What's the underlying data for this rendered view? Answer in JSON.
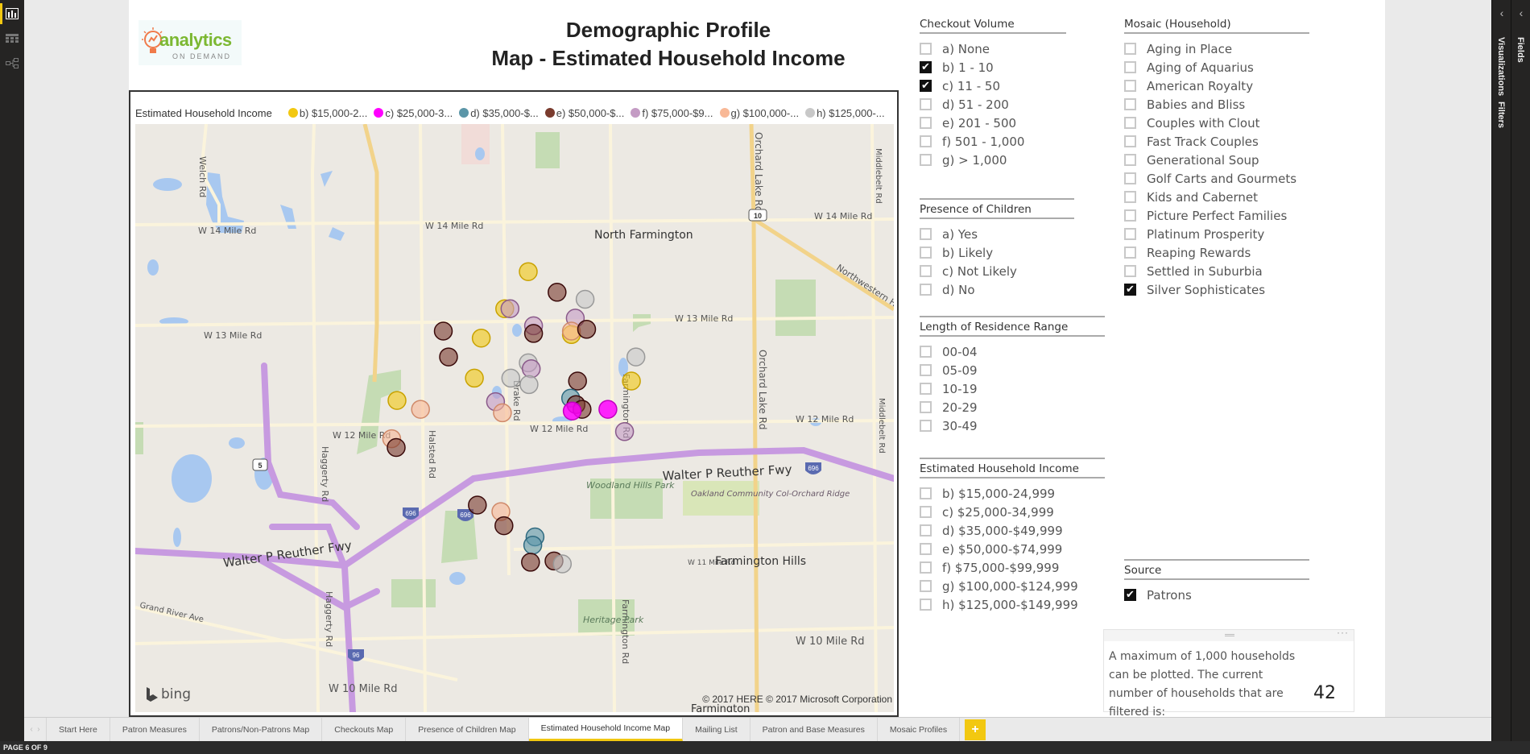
{
  "report": {
    "title_line1": "Demographic Profile",
    "title_line2": "Map - Estimated Household Income",
    "logo_word": "analytics",
    "logo_sub": "ON DEMAND"
  },
  "left_nav": [
    {
      "icon": "report-view-icon",
      "active": true
    },
    {
      "icon": "data-view-icon",
      "active": false
    },
    {
      "icon": "relationships-view-icon",
      "active": false
    }
  ],
  "right_panes": {
    "fields": "Fields",
    "visualizations": "Visualizations",
    "filters": "Filters",
    "collapse_glyph": "‹"
  },
  "map_visual": {
    "legend_title": "Estimated Household Income",
    "legend": [
      {
        "label": "b) $15,000-2...",
        "color": "#f2c811"
      },
      {
        "label": "c) $25,000-3...",
        "color": "#ff00ff"
      },
      {
        "label": "d) $35,000-$...",
        "color": "#5b96a8"
      },
      {
        "label": "e) $50,000-$...",
        "color": "#7a3b2e"
      },
      {
        "label": "f) $75,000-$9...",
        "color": "#c49bc4"
      },
      {
        "label": "g) $100,000-...",
        "color": "#f8b896"
      },
      {
        "label": "h) $125,000-...",
        "color": "#c8c8c8"
      }
    ],
    "labels": {
      "north_farmington": "North Farmington",
      "farmington_hills": "Farmington Hills",
      "w14": "W 14 Mile Rd",
      "w13": "W 13 Mile Rd",
      "w12": "W 12 Mile Rd",
      "w11": "W 11 Mile Rd",
      "w10": "W 10 Mile Rd",
      "welch": "Welch Rd",
      "haggerty": "Haggerty Rd",
      "halsted": "Halsted Rd",
      "drake": "Drake Rd",
      "farmington_rd": "Farmington Rd",
      "orchard_lake": "Orchard Lake Rd",
      "middlebelt": "Middlebelt Rd",
      "northwestern": "Northwestern Hwy",
      "grand_river": "Grand River Ave",
      "reuther": "Walter P Reuther Fwy",
      "woodland": "Woodland Hills Park",
      "oakland": "Oakland Community Col-Orchard Ridge",
      "heritage": "Heritage Park",
      "farmington": "Farmington",
      "shield_5": "5",
      "shield_10": "10",
      "shield_696": "696",
      "shield_96": "96",
      "bing": "bing",
      "copyright": "© 2017 HERE    © 2017 Microsoft Corporation"
    },
    "points": [
      {
        "cat": "b",
        "lon": 0.518,
        "lat": 0.251
      },
      {
        "cat": "e",
        "lon": 0.556,
        "lat": 0.286
      },
      {
        "cat": "h",
        "lon": 0.593,
        "lat": 0.298
      },
      {
        "cat": "b",
        "lon": 0.487,
        "lat": 0.314
      },
      {
        "cat": "f",
        "lon": 0.494,
        "lat": 0.314
      },
      {
        "cat": "f",
        "lon": 0.58,
        "lat": 0.33
      },
      {
        "cat": "e",
        "lon": 0.406,
        "lat": 0.352
      },
      {
        "cat": "b",
        "lon": 0.456,
        "lat": 0.364
      },
      {
        "cat": "f",
        "lon": 0.525,
        "lat": 0.343
      },
      {
        "cat": "e",
        "lon": 0.525,
        "lat": 0.356
      },
      {
        "cat": "b",
        "lon": 0.575,
        "lat": 0.358
      },
      {
        "cat": "g",
        "lon": 0.575,
        "lat": 0.352
      },
      {
        "cat": "e",
        "lon": 0.595,
        "lat": 0.349
      },
      {
        "cat": "e",
        "lon": 0.413,
        "lat": 0.396
      },
      {
        "cat": "h",
        "lon": 0.66,
        "lat": 0.396
      },
      {
        "cat": "h",
        "lon": 0.518,
        "lat": 0.406
      },
      {
        "cat": "f",
        "lon": 0.522,
        "lat": 0.416
      },
      {
        "cat": "b",
        "lon": 0.447,
        "lat": 0.432
      },
      {
        "cat": "h",
        "lon": 0.495,
        "lat": 0.432
      },
      {
        "cat": "h",
        "lon": 0.519,
        "lat": 0.443
      },
      {
        "cat": "e",
        "lon": 0.583,
        "lat": 0.437
      },
      {
        "cat": "b",
        "lon": 0.654,
        "lat": 0.437
      },
      {
        "cat": "b",
        "lon": 0.345,
        "lat": 0.47
      },
      {
        "cat": "d",
        "lon": 0.574,
        "lat": 0.466
      },
      {
        "cat": "f",
        "lon": 0.475,
        "lat": 0.472
      },
      {
        "cat": "g",
        "lon": 0.484,
        "lat": 0.491
      },
      {
        "cat": "g",
        "lon": 0.376,
        "lat": 0.485
      },
      {
        "cat": "e",
        "lon": 0.581,
        "lat": 0.477
      },
      {
        "cat": "e",
        "lon": 0.589,
        "lat": 0.485
      },
      {
        "cat": "c",
        "lon": 0.576,
        "lat": 0.488
      },
      {
        "cat": "c",
        "lon": 0.623,
        "lat": 0.485
      },
      {
        "cat": "f",
        "lon": 0.645,
        "lat": 0.523
      },
      {
        "cat": "g",
        "lon": 0.338,
        "lat": 0.535
      },
      {
        "cat": "e",
        "lon": 0.344,
        "lat": 0.55
      },
      {
        "cat": "e",
        "lon": 0.451,
        "lat": 0.648
      },
      {
        "cat": "g",
        "lon": 0.482,
        "lat": 0.659
      },
      {
        "cat": "e",
        "lon": 0.486,
        "lat": 0.683
      },
      {
        "cat": "d",
        "lon": 0.527,
        "lat": 0.702
      },
      {
        "cat": "d",
        "lon": 0.524,
        "lat": 0.716
      },
      {
        "cat": "e",
        "lon": 0.521,
        "lat": 0.745
      },
      {
        "cat": "e",
        "lon": 0.552,
        "lat": 0.743
      },
      {
        "cat": "h",
        "lon": 0.563,
        "lat": 0.748
      }
    ]
  },
  "slicers": {
    "checkout_volume": {
      "title": "Checkout Volume",
      "options": [
        {
          "label": "a) None",
          "checked": false
        },
        {
          "label": "b) 1 - 10",
          "checked": true
        },
        {
          "label": "c) 11 - 50",
          "checked": true
        },
        {
          "label": "d) 51 - 200",
          "checked": false
        },
        {
          "label": "e) 201 - 500",
          "checked": false
        },
        {
          "label": "f) 501 - 1,000",
          "checked": false
        },
        {
          "label": "g) > 1,000",
          "checked": false
        }
      ]
    },
    "presence_of_children": {
      "title": "Presence of Children",
      "options": [
        {
          "label": "a) Yes",
          "checked": false
        },
        {
          "label": "b) Likely",
          "checked": false
        },
        {
          "label": "c) Not Likely",
          "checked": false
        },
        {
          "label": "d) No",
          "checked": false
        }
      ]
    },
    "length_of_residence": {
      "title": "Length of Residence Range",
      "options": [
        {
          "label": "00-04",
          "checked": false
        },
        {
          "label": "05-09",
          "checked": false
        },
        {
          "label": "10-19",
          "checked": false
        },
        {
          "label": "20-29",
          "checked": false
        },
        {
          "label": "30-49",
          "checked": false
        }
      ]
    },
    "household_income": {
      "title": "Estimated Household Income",
      "options": [
        {
          "label": "b) $15,000-24,999",
          "checked": false
        },
        {
          "label": "c) $25,000-34,999",
          "checked": false
        },
        {
          "label": "d) $35,000-$49,999",
          "checked": false
        },
        {
          "label": "e) $50,000-$74,999",
          "checked": false
        },
        {
          "label": "f) $75,000-$99,999",
          "checked": false
        },
        {
          "label": "g) $100,000-$124,999",
          "checked": false
        },
        {
          "label": "h) $125,000-$149,999",
          "checked": false
        }
      ]
    },
    "mosaic": {
      "title": "Mosaic (Household)",
      "options": [
        {
          "label": "Aging in Place",
          "checked": false
        },
        {
          "label": "Aging of Aquarius",
          "checked": false
        },
        {
          "label": "American Royalty",
          "checked": false
        },
        {
          "label": "Babies and Bliss",
          "checked": false
        },
        {
          "label": "Couples with Clout",
          "checked": false
        },
        {
          "label": "Fast Track Couples",
          "checked": false
        },
        {
          "label": "Generational Soup",
          "checked": false
        },
        {
          "label": "Golf Carts and Gourmets",
          "checked": false
        },
        {
          "label": "Kids and Cabernet",
          "checked": false
        },
        {
          "label": "Picture Perfect Families",
          "checked": false
        },
        {
          "label": "Platinum Prosperity",
          "checked": false
        },
        {
          "label": "Reaping Rewards",
          "checked": false
        },
        {
          "label": "Settled in Suburbia",
          "checked": false
        },
        {
          "label": "Silver Sophisticates",
          "checked": true
        }
      ]
    },
    "source": {
      "title": "Source",
      "options": [
        {
          "label": "Patrons",
          "checked": true
        }
      ]
    }
  },
  "card": {
    "text": "A maximum of 1,000 households can be plotted. The current number of households that are filtered is:",
    "value": "42",
    "more": "···"
  },
  "tabs": {
    "items": [
      "Start Here",
      "Patron Measures",
      "Patrons/Non-Patrons Map",
      "Checkouts Map",
      "Presence of Children Map",
      "Estimated Household Income Map",
      "Mailing List",
      "Patron and Base Measures",
      "Mosaic Profiles"
    ],
    "active_index": 5,
    "add_label": "+",
    "nav_prev": "‹",
    "nav_next": "›"
  },
  "status": {
    "page_indicator": "PAGE 6 OF 9"
  }
}
